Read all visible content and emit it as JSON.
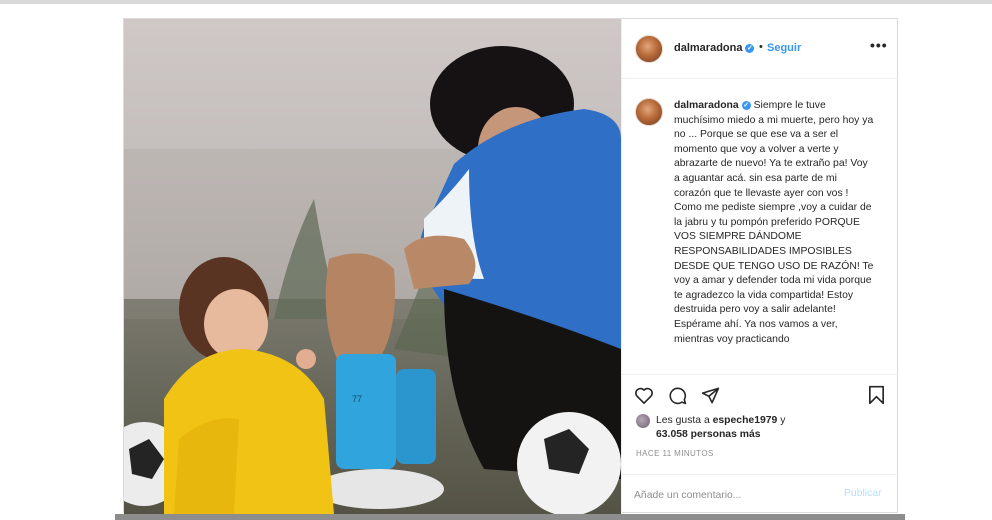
{
  "post": {
    "username": "dalmaradona",
    "follow_label": "Seguir",
    "dot": "•",
    "more_label": "•••",
    "caption_text": "Siempre le tuve muchísimo miedo a mi muerte, pero hoy ya no ... Porque se que ese va a ser el momento que voy a volver a verte y abrazarte de nuevo! Ya te extraño pa! Voy a aguantar acá. sin esa parte de mi corazón que te llevaste ayer con vos ! Como me pediste siempre ,voy a cuidar de la jabru y tu pompón preferido PORQUE VOS SIEMPRE DÁNDOME RESPONSABILIDADES IMPOSIBLES DESDE QUE TENGO USO DE RAZÓN! Te voy a amar y defender toda mi vida porque te agradezco la vida compartida! Estoy destruida pero voy a salir adelante! Espérame ahí. Ya nos vamos a ver, mientras voy practicando",
    "likes_prefix": "Les gusta a",
    "likes_user": "espeche1979",
    "likes_joiner": "y",
    "likes_count": "63.058 personas más",
    "timestamp": "HACE 11 MINUTOS",
    "comment_placeholder": "Añade un comentario...",
    "publish_label": "Publicar"
  },
  "icons": {
    "like": "heart-icon",
    "comment": "comment-icon",
    "share": "share-icon",
    "save": "bookmark-icon",
    "verified": "verified-badge-icon",
    "more": "more-options-icon"
  },
  "colors": {
    "link_blue": "#3897f0",
    "publish_disabled": "#b2dffc",
    "muted": "#8e8e8e",
    "text": "#262626"
  }
}
